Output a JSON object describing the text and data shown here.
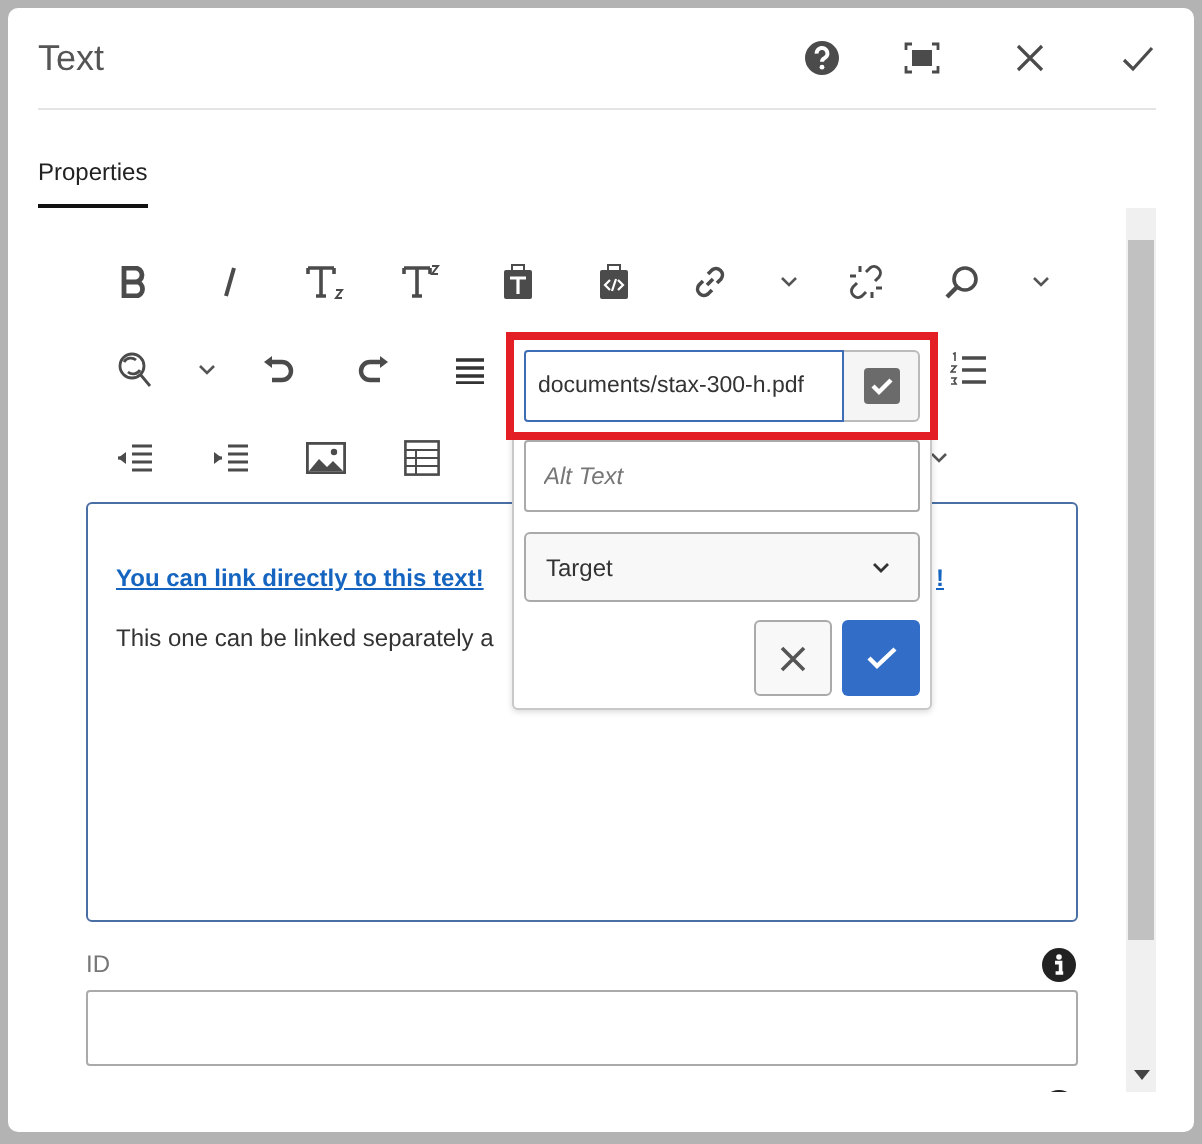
{
  "dialog": {
    "title": "Text",
    "header_buttons": [
      {
        "kind": "help"
      },
      {
        "kind": "fullscreen"
      },
      {
        "kind": "close"
      },
      {
        "kind": "confirm"
      }
    ]
  },
  "tabs": [
    {
      "label": "Properties",
      "selected": true
    }
  ],
  "toolbar": [
    [
      {
        "kind": "bold"
      },
      {
        "kind": "italic"
      },
      {
        "kind": "subscript"
      },
      {
        "kind": "superscript"
      },
      {
        "kind": "paste-text"
      },
      {
        "kind": "paste-html"
      },
      {
        "kind": "link"
      },
      {
        "kind": "caret"
      },
      {
        "kind": "unlink"
      },
      {
        "kind": "find"
      },
      {
        "kind": "caret"
      }
    ],
    [
      {
        "kind": "find-replace"
      },
      {
        "kind": "caret"
      },
      {
        "kind": "undo"
      },
      {
        "kind": "redo"
      },
      {
        "kind": "justify"
      },
      {
        "kind": "numbered-list",
        "gap_before": true
      }
    ],
    [
      {
        "kind": "outdent"
      },
      {
        "kind": "indent"
      },
      {
        "kind": "image"
      },
      {
        "kind": "table"
      },
      {
        "kind": "caret",
        "gap_before": true
      }
    ]
  ],
  "editor": {
    "link_text": "You can link directly to this text!",
    "link_tail": "!",
    "paragraph": "This one can be linked separately a"
  },
  "fields": [
    {
      "label": "ID"
    }
  ],
  "link_popover": {
    "url": "documents/stax-300-h.pdf",
    "url_highlighted": true,
    "alt_placeholder": "Alt Text",
    "target_placeholder": "Target"
  }
}
